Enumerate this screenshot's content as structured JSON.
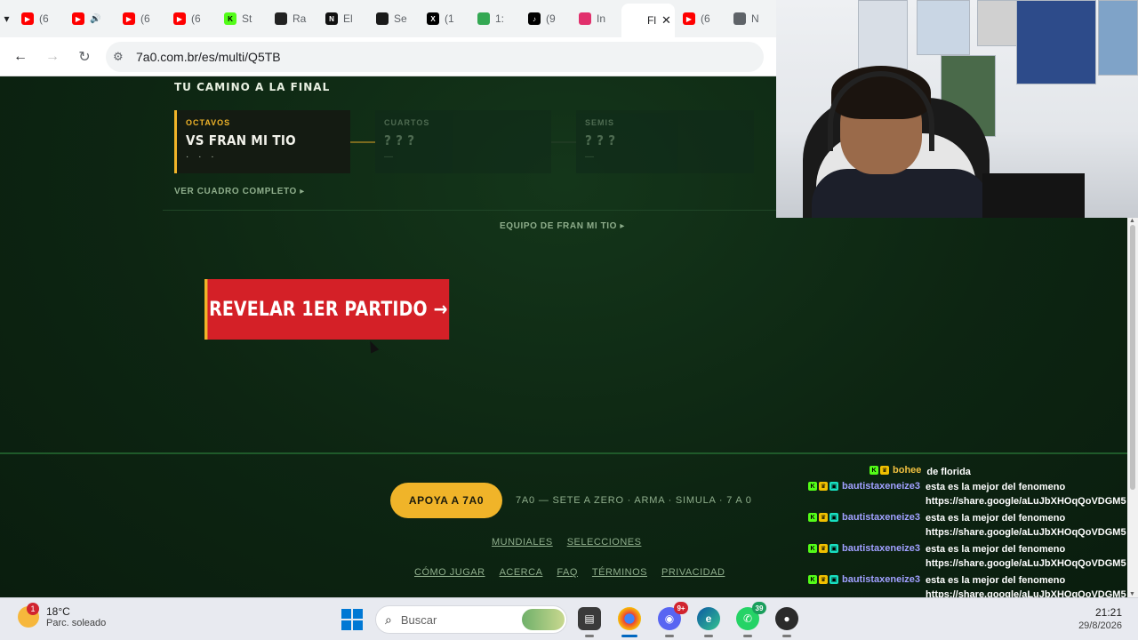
{
  "browser": {
    "tabs": [
      {
        "label": "(6",
        "icon": "youtube-icon",
        "color": "#ff0000"
      },
      {
        "label": "",
        "icon": "youtube-icon",
        "color": "#ff0000",
        "audio": true
      },
      {
        "label": "(6",
        "icon": "youtube-icon",
        "color": "#ff0000"
      },
      {
        "label": "(6",
        "icon": "youtube-icon",
        "color": "#ff0000"
      },
      {
        "label": "St",
        "icon": "kick-icon",
        "color": "#53fc18"
      },
      {
        "label": "Ra",
        "icon": "generic-site-icon",
        "color": "#222222"
      },
      {
        "label": "El",
        "icon": "news-icon",
        "color": "#111111"
      },
      {
        "label": "Se",
        "icon": "grid-site-icon",
        "color": "#1a1a1a"
      },
      {
        "label": "(1",
        "icon": "x-icon",
        "color": "#000000"
      },
      {
        "label": "1:",
        "icon": "maps-pin-icon",
        "color": "#34a853"
      },
      {
        "label": "(9",
        "icon": "tiktok-icon",
        "color": "#000000"
      },
      {
        "label": "In",
        "icon": "instagram-icon",
        "color": "#e1306c"
      },
      {
        "label": "Fl",
        "icon": "site-icon",
        "color": "#ffffff",
        "active": true
      },
      {
        "label": "(6",
        "icon": "youtube-icon",
        "color": "#ff0000"
      },
      {
        "label": "N",
        "icon": "chrome-icon",
        "color": "#5f6368"
      }
    ],
    "url": "7a0.com.br/es/multi/Q5TB"
  },
  "page": {
    "section_title": "TU CAMINO A LA FINAL",
    "rounds": [
      {
        "label": "OCTAVOS",
        "opponent": "VS FRAN MI TIO",
        "dots": "· · ·",
        "active": true
      },
      {
        "label": "CUARTOS",
        "opponent": "? ? ?",
        "dots": "—",
        "active": false
      },
      {
        "label": "SEMIS",
        "opponent": "? ? ?",
        "dots": "—",
        "active": false
      }
    ],
    "bracket_link": "VER CUADRO COMPLETO ▸",
    "team_link": "EQUIPO DE FRAN MI TIO ▸",
    "reveal_button": "REVELAR 1ER PARTIDO →",
    "support_button": "APOYA A 7A0",
    "tagline": "7A0 — SETE A ZERO · ARMA · SIMULA · 7 A 0",
    "footer_links_row1": [
      "MUNDIALES",
      "SELECCIONES"
    ],
    "footer_links_row2": [
      "CÓMO JUGAR",
      "ACERCA",
      "FAQ",
      "TÉRMINOS",
      "PRIVACIDAD"
    ],
    "colors": {
      "accent": "#f0b429",
      "cta": "#d42027",
      "background": "#0c1f10"
    }
  },
  "chat": [
    {
      "user": "bohee",
      "message": "de florida",
      "badges": [
        "kick",
        "crown"
      ],
      "gold": true
    },
    {
      "user": "bautistaxeneize3",
      "message": "esta es la mejor del fenomeno",
      "link": "https://share.google/aLuJbXHOqQoVDGM5",
      "badges": [
        "kick",
        "crown",
        "gift"
      ]
    },
    {
      "user": "bautistaxeneize3",
      "message": "esta es la mejor del fenomeno",
      "link": "https://share.google/aLuJbXHOqQoVDGM5",
      "badges": [
        "kick",
        "crown",
        "gift"
      ]
    },
    {
      "user": "bautistaxeneize3",
      "message": "esta es la mejor del fenomeno",
      "link": "https://share.google/aLuJbXHOqQoVDGM5",
      "badges": [
        "kick",
        "crown",
        "gift"
      ]
    },
    {
      "user": "bautistaxeneize3",
      "message": "esta es la mejor del fenomeno",
      "link": "https://share.google/aLuJbXHOqQoVDGM5",
      "badges": [
        "kick",
        "crown",
        "gift"
      ]
    }
  ],
  "taskbar": {
    "weather_temp": "18°C",
    "weather_desc": "Parc. soleado",
    "weather_badge": "1",
    "search_placeholder": "Buscar",
    "discord_badge": "9+",
    "whatsapp_badge": "39",
    "time": "21:21",
    "date": "29/8/2026"
  }
}
